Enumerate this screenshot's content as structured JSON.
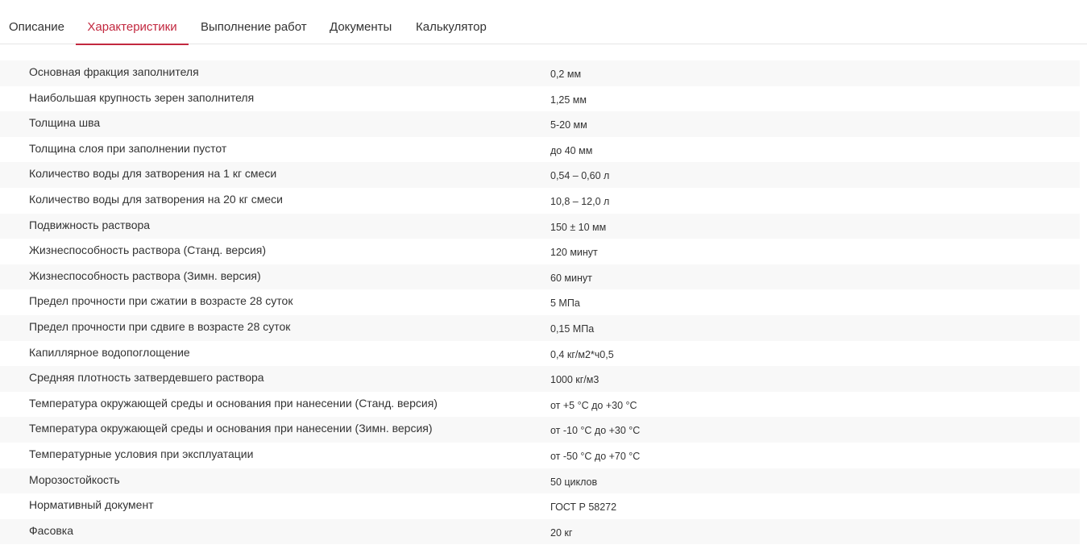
{
  "tabs": [
    {
      "label": "Описание",
      "active": false
    },
    {
      "label": "Характеристики",
      "active": true
    },
    {
      "label": "Выполнение работ",
      "active": false
    },
    {
      "label": "Документы",
      "active": false
    },
    {
      "label": "Калькулятор",
      "active": false
    }
  ],
  "colors": {
    "accent": "#c2283f",
    "row_stripe": "#f8f8f8",
    "text": "#333333"
  },
  "specs": [
    {
      "name": "Основная фракция заполнителя",
      "value": "0,2 мм"
    },
    {
      "name": "Наибольшая крупность зерен заполнителя",
      "value": "1,25 мм"
    },
    {
      "name": "Толщина шва",
      "value": "5-20 мм"
    },
    {
      "name": "Толщина слоя при заполнении пустот",
      "value": "до 40 мм"
    },
    {
      "name": "Количество воды для затворения на 1 кг смеси",
      "value": "0,54 – 0,60 л"
    },
    {
      "name": "Количество воды для затворения на 20 кг смеси",
      "value": "10,8 – 12,0 л"
    },
    {
      "name": "Подвижность раствора",
      "value": "150 ± 10 мм"
    },
    {
      "name": "Жизнеспособность раствора (Станд. версия)",
      "value": "120 минут"
    },
    {
      "name": "Жизнеспособность раствора (Зимн. версия)",
      "value": "60 минут"
    },
    {
      "name": "Предел прочности при сжатии в возрасте 28 суток",
      "value": "5 МПа"
    },
    {
      "name": "Предел прочности при сдвиге в возрасте 28 суток",
      "value": "0,15 МПа"
    },
    {
      "name": "Капиллярное водопоглощение",
      "value": "0,4 кг/м2*ч0,5"
    },
    {
      "name": "Средняя плотность затвердевшего раствора",
      "value": "1000 кг/м3"
    },
    {
      "name": "Температура окружающей среды и основания при нанесении (Станд. версия)",
      "value": "от +5 °C до +30 °C"
    },
    {
      "name": "Температура окружающей среды и основания при нанесении (Зимн. версия)",
      "value": "от -10 °C до +30 °C"
    },
    {
      "name": "Температурные условия при эксплуатации",
      "value": "от -50 °C до +70 °C"
    },
    {
      "name": "Морозостойкость",
      "value": "50 циклов"
    },
    {
      "name": "Нормативный документ",
      "value": "ГОСТ Р 58272"
    },
    {
      "name": "Фасовка",
      "value": "20 кг"
    }
  ]
}
